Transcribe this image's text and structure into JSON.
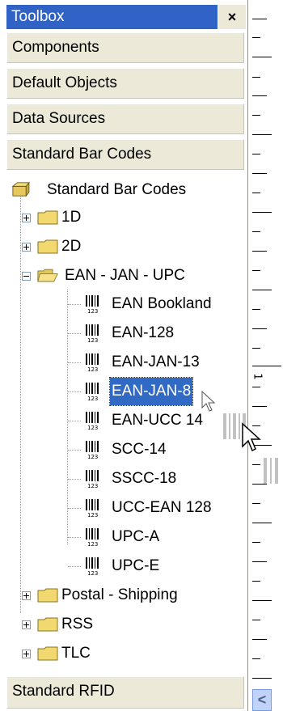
{
  "toolbox": {
    "title": "Toolbox",
    "close_glyph": "×",
    "categories_top": [
      "Components",
      "Default Objects",
      "Data Sources",
      "Standard Bar Codes"
    ],
    "category_bottom": "Standard RFID"
  },
  "tree": {
    "root": "Standard Bar Codes",
    "folder_1d": "1D",
    "folder_2d": "2D",
    "folder_ean": "EAN - JAN - UPC",
    "items": [
      "EAN Bookland",
      "EAN-128",
      "EAN-JAN-13",
      "EAN-JAN-8",
      "EAN-UCC 14",
      "SCC-14",
      "SSCC-18",
      "UCC-EAN 128",
      "UPC-A",
      "UPC-E"
    ],
    "selected": "EAN-JAN-8",
    "folder_postal": "Postal - Shipping",
    "folder_rss": "RSS",
    "folder_tlc": "TLC"
  },
  "ruler": {
    "label": "1"
  },
  "scrollbar": {
    "left_arrow": "<"
  },
  "colors": {
    "title_bar": "#3162c5",
    "selection": "#316ac5",
    "category_bg": "#ece9d8"
  },
  "icons": [
    "close-icon",
    "package-icon",
    "folder-icon",
    "open-folder-icon",
    "barcode-icon",
    "expand-icon",
    "collapse-icon",
    "drag-cursor-icon"
  ]
}
